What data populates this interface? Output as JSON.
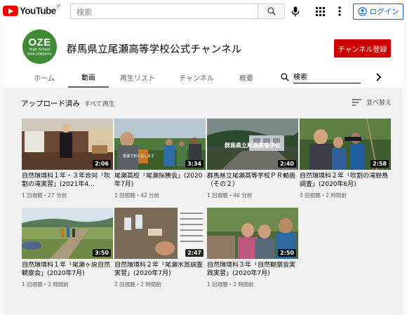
{
  "masthead": {
    "logo_text": "YouTube",
    "logo_region": "JP",
    "search_placeholder": "検索",
    "login_label": "ログイン"
  },
  "channel": {
    "avatar_line1": "OZE",
    "avatar_line2": "High School",
    "avatar_line3": "群馬県立尾瀬高等学校",
    "title": "群馬県立尾瀬高等学校公式チャンネル",
    "subscribe_label": "チャンネル登録",
    "tabs": [
      {
        "label": "ホーム",
        "active": false
      },
      {
        "label": "動画",
        "active": true
      },
      {
        "label": "再生リスト",
        "active": false
      },
      {
        "label": "チャンネル",
        "active": false
      },
      {
        "label": "概要",
        "active": false
      }
    ],
    "tab_search_value": "検索"
  },
  "section": {
    "title": "アップロード済み",
    "play_all": "すべて再生",
    "sort_label": "並べ替え"
  },
  "videos": [
    {
      "title": "自然環境科１年・３年合同「吹割の滝実習」(2021年4...",
      "meta": "1 回視聴・27 分前",
      "duration": "2:06",
      "thumb_text": ""
    },
    {
      "title": "尾瀬高校「尾瀬探勝会」(2020年7月)",
      "meta": "1 回視聴・42 分前",
      "duration": "3:34",
      "thumb_text": "尾瀬で知り返します"
    },
    {
      "title": "群馬県立尾瀬高等学校ＰＲ動画（その２）",
      "meta": "1 回視聴・46 分前",
      "duration": "2:40",
      "thumb_text": "群馬県立尾瀬高等学校"
    },
    {
      "title": "自然環境科２年「吹割の滝野鳥調査」(2020年6月)",
      "meta": "3 回視聴・2 時間前",
      "duration": "2:58",
      "thumb_text": ""
    },
    {
      "title": "自然環境科１年「尾瀬ヶ原自然観察会」(2020年7月)",
      "meta": "1 回視聴・2 時間前",
      "duration": "3:50",
      "thumb_text": ""
    },
    {
      "title": "自然環境科２年「尾瀬水質調査実習」(2020年7月)",
      "meta": "2 回視聴・2 時間前",
      "duration": "2:47",
      "thumb_text": ""
    },
    {
      "title": "自然環境科３年「自然観察会実践実習」(2020年7月)",
      "meta": "1 回視聴・2 時間前",
      "duration": "2:50",
      "thumb_text": ""
    }
  ],
  "colors": {
    "brand_red": "#ff0000",
    "subscribe_red": "#cc0000",
    "link_blue": "#065fd4",
    "avatar_green": "#3f8a35"
  }
}
